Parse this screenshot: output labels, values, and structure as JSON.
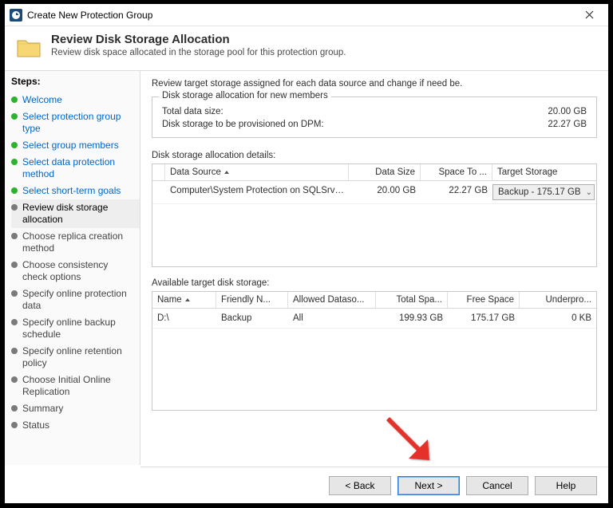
{
  "window": {
    "title": "Create New Protection Group"
  },
  "header": {
    "heading": "Review Disk Storage Allocation",
    "subtitle": "Review disk space allocated in the storage pool for this protection group."
  },
  "sidebar": {
    "title": "Steps:",
    "steps": [
      {
        "label": "Welcome",
        "state": "done"
      },
      {
        "label": "Select protection group type",
        "state": "done"
      },
      {
        "label": "Select group members",
        "state": "done"
      },
      {
        "label": "Select data protection method",
        "state": "done"
      },
      {
        "label": "Select short-term goals",
        "state": "done"
      },
      {
        "label": "Review disk storage allocation",
        "state": "current"
      },
      {
        "label": "Choose replica creation method",
        "state": "todo"
      },
      {
        "label": "Choose consistency check options",
        "state": "todo"
      },
      {
        "label": "Specify online protection data",
        "state": "todo"
      },
      {
        "label": "Specify online backup schedule",
        "state": "todo"
      },
      {
        "label": "Specify online retention policy",
        "state": "todo"
      },
      {
        "label": "Choose Initial Online Replication",
        "state": "todo"
      },
      {
        "label": "Summary",
        "state": "todo"
      },
      {
        "label": "Status",
        "state": "todo"
      }
    ]
  },
  "main": {
    "instructions": "Review target storage assigned for each data source and change if need be.",
    "new_members": {
      "legend": "Disk storage allocation for new members",
      "total_label": "Total data size:",
      "total_value": "20.00 GB",
      "prov_label": "Disk storage to be provisioned on DPM:",
      "prov_value": "22.27 GB"
    },
    "details": {
      "label": "Disk storage allocation details:",
      "columns": {
        "data_source": "Data Source",
        "data_size": "Data Size",
        "space_to": "Space To ...",
        "target_storage": "Target Storage"
      },
      "row": {
        "data_source": "Computer\\System Protection on SQLSrv1.d...",
        "data_size": "20.00  GB",
        "space_to": "22.27 GB",
        "target_selected": "Backup - 175.17 GB"
      }
    },
    "available": {
      "label": "Available target disk storage:",
      "columns": {
        "name": "Name",
        "friendly": "Friendly N...",
        "allowed": "Allowed Dataso...",
        "total": "Total Spa...",
        "free": "Free Space",
        "under": "Underpro..."
      },
      "row": {
        "name": "D:\\",
        "friendly": "Backup",
        "allowed": "All",
        "total": "199.93 GB",
        "free": "175.17 GB",
        "under": "0 KB"
      }
    }
  },
  "buttons": {
    "back": "< Back",
    "next": "Next >",
    "cancel": "Cancel",
    "help": "Help"
  }
}
